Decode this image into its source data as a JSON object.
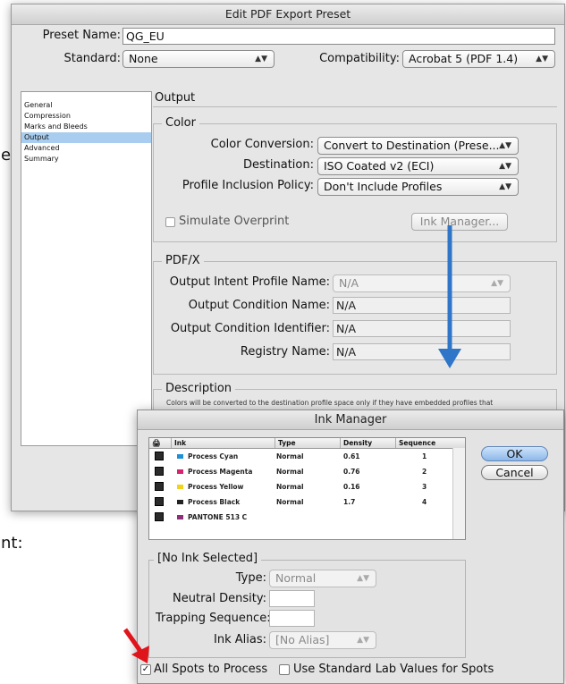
{
  "background_fragments": {
    "frag1": "er",
    "frag2": "nt:"
  },
  "main_dialog": {
    "title": "Edit PDF Export Preset",
    "preset_name_label": "Preset Name:",
    "preset_name_value": "QG_EU",
    "standard_label": "Standard:",
    "standard_value": "None",
    "compatibility_label": "Compatibility:",
    "compatibility_value": "Acrobat 5 (PDF 1.4)",
    "sidebar": {
      "items": [
        {
          "label": "General",
          "active": false
        },
        {
          "label": "Compression",
          "active": false
        },
        {
          "label": "Marks and Bleeds",
          "active": false
        },
        {
          "label": "Output",
          "active": true
        },
        {
          "label": "Advanced",
          "active": false
        },
        {
          "label": "Summary",
          "active": false
        }
      ]
    },
    "section_title": "Output",
    "color_group": {
      "legend": "Color",
      "color_conversion_label": "Color Conversion:",
      "color_conversion_value": "Convert to Destination (Prese...",
      "destination_label": "Destination:",
      "destination_value": "ISO Coated v2 (ECI)",
      "profile_policy_label": "Profile Inclusion Policy:",
      "profile_policy_value": "Don't Include Profiles",
      "simulate_overprint_label": "Simulate Overprint",
      "ink_manager_button": "Ink Manager..."
    },
    "pdfx_group": {
      "legend": "PDF/X",
      "output_intent_label": "Output Intent Profile Name:",
      "output_intent_value": "N/A",
      "output_condition_name_label": "Output Condition Name:",
      "output_condition_name_value": "N/A",
      "output_condition_id_label": "Output Condition Identifier:",
      "output_condition_id_value": "N/A",
      "registry_name_label": "Registry Name:",
      "registry_name_value": "N/A"
    },
    "description_group": {
      "legend": "Description",
      "text": "Colors will be converted to the destination profile space only if they have embedded profiles that"
    }
  },
  "ink_manager": {
    "title": "Ink Manager",
    "columns": [
      "Ink",
      "Type",
      "Density",
      "Sequence"
    ],
    "inks": [
      {
        "name": "Process Cyan",
        "type": "Normal",
        "density": "0.61",
        "sequence": "1",
        "color": "#1f8fd6"
      },
      {
        "name": "Process Magenta",
        "type": "Normal",
        "density": "0.76",
        "sequence": "2",
        "color": "#d6246e"
      },
      {
        "name": "Process Yellow",
        "type": "Normal",
        "density": "0.16",
        "sequence": "3",
        "color": "#f2d31a"
      },
      {
        "name": "Process Black",
        "type": "Normal",
        "density": "1.7",
        "sequence": "4",
        "color": "#222222"
      },
      {
        "name": "PANTONE 513 C",
        "type": "",
        "density": "",
        "sequence": "",
        "color": "#8e2f7a"
      }
    ],
    "ok_label": "OK",
    "cancel_label": "Cancel",
    "no_ink_legend": "[No Ink Selected]",
    "type_label": "Type:",
    "type_value": "Normal",
    "neutral_density_label": "Neutral Density:",
    "trapping_sequence_label": "Trapping Sequence:",
    "ink_alias_label": "Ink Alias:",
    "ink_alias_value": "[No Alias]",
    "all_spots_label": "All Spots to Process",
    "all_spots_checked": true,
    "lab_values_label": "Use Standard Lab Values for Spots",
    "lab_values_checked": false
  },
  "annotations": {
    "arrow_color": "#2f75c8",
    "pointer_color": "#e0141b"
  }
}
